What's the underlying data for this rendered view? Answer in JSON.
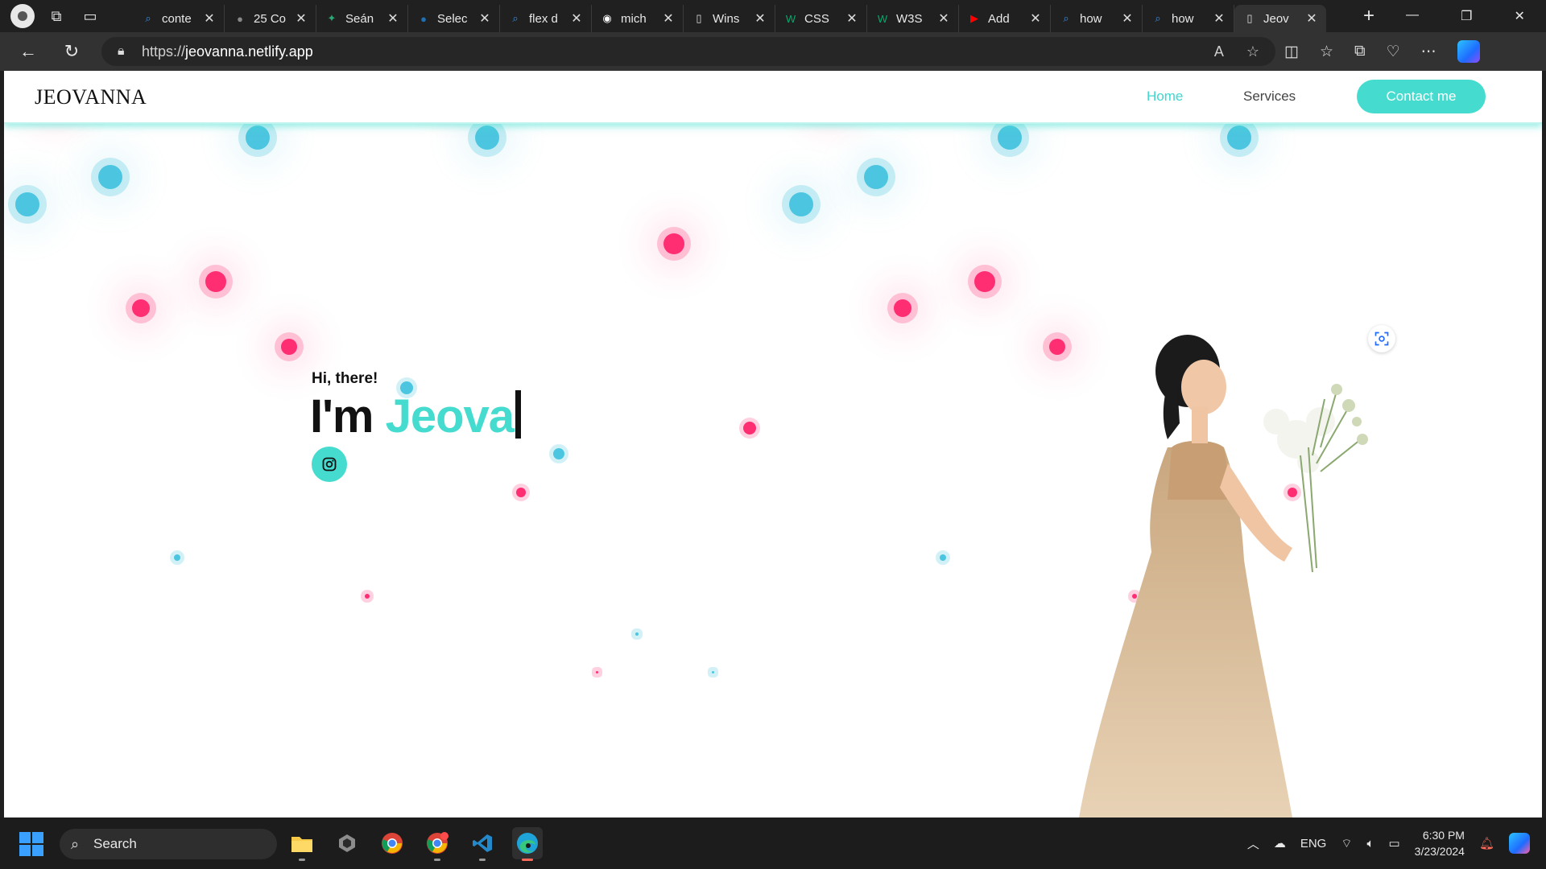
{
  "browser": {
    "tabs": [
      {
        "title": "conte",
        "icon": "search-icon",
        "color": "#3a8dde"
      },
      {
        "title": "25 Co",
        "icon": "site-icon",
        "color": "#888888"
      },
      {
        "title": "Seán",
        "icon": "star-icon",
        "color": "#2aa876"
      },
      {
        "title": "Selec",
        "icon": "site-icon",
        "color": "#1f6fb2"
      },
      {
        "title": "flex d",
        "icon": "search-icon",
        "color": "#3a8dde"
      },
      {
        "title": "mich",
        "icon": "github-icon",
        "color": "#ffffff"
      },
      {
        "title": "Wins",
        "icon": "page-icon",
        "color": "#dddddd"
      },
      {
        "title": "CSS",
        "icon": "w3-icon",
        "color": "#04aa6d"
      },
      {
        "title": "W3S",
        "icon": "w3-icon",
        "color": "#04aa6d"
      },
      {
        "title": "Add",
        "icon": "youtube-icon",
        "color": "#ff0000"
      },
      {
        "title": "how",
        "icon": "search-icon",
        "color": "#3a8dde"
      },
      {
        "title": "how",
        "icon": "search-icon",
        "color": "#3a8dde"
      },
      {
        "title": "Jeov",
        "icon": "page-icon",
        "color": "#dddddd",
        "active": true
      }
    ],
    "url_prefix": "https://",
    "url_host": "jeovanna.netlify.app"
  },
  "site": {
    "logo": "JEOVANNA",
    "nav": {
      "home": "Home",
      "services": "Services"
    },
    "contact_button": "Contact me",
    "greeting": "Hi, there!",
    "headline_prefix": "I'm",
    "headline_name": "Jeova",
    "accent_color": "#45dccf",
    "dot_colors": {
      "blue": "#4cc6e0",
      "pink": "#ff2e72"
    }
  },
  "taskbar": {
    "search_label": "Search",
    "language": "ENG",
    "time": "6:30 PM",
    "date": "3/23/2024",
    "apps": [
      "file-explorer-icon",
      "settings-app-icon",
      "chrome-icon",
      "chrome-notify-icon",
      "vscode-icon",
      "edge-icon"
    ]
  }
}
